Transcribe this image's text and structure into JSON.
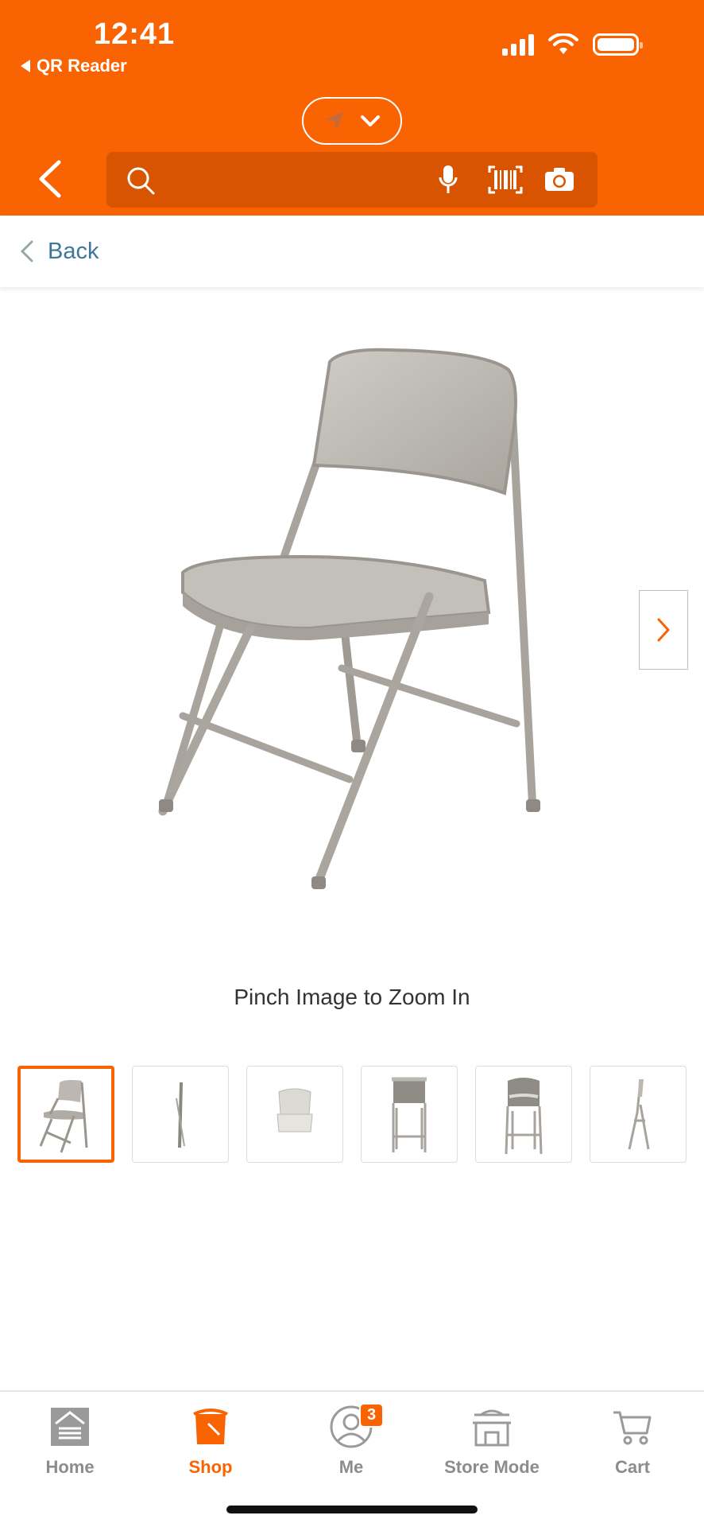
{
  "status_bar": {
    "time": "12:41",
    "back_app": "QR Reader"
  },
  "header": {
    "search_placeholder": "",
    "accent_color": "#f96302"
  },
  "back_row": {
    "label": "Back"
  },
  "product": {
    "image_icon": "folding-chair-image",
    "zoom_hint": "Pinch Image to Zoom In",
    "thumbnail_count": 6,
    "selected_thumbnail": 1
  },
  "bottom_nav": {
    "items": [
      {
        "label": "Home",
        "icon": "home-depot-logo-icon"
      },
      {
        "label": "Shop",
        "icon": "shop-bucket-icon"
      },
      {
        "label": "Me",
        "icon": "user-icon",
        "badge": "3"
      },
      {
        "label": "Store Mode",
        "icon": "store-icon"
      },
      {
        "label": "Cart",
        "icon": "cart-icon"
      }
    ],
    "active_index": 1
  }
}
